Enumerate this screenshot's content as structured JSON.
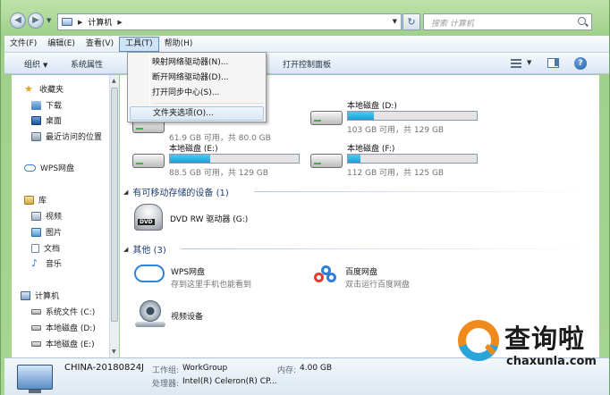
{
  "address_bar": {
    "location": "计算机",
    "search_placeholder": "搜索 计算机"
  },
  "menubar": {
    "items": [
      "文件(F)",
      "编辑(E)",
      "查看(V)",
      "工具(T)",
      "帮助(H)"
    ],
    "active_index": 3
  },
  "toolbar": {
    "organize": "组织",
    "properties": "系统属性",
    "control_panel": "打开控制面板"
  },
  "tools_menu": {
    "items": [
      "映射网络驱动器(N)...",
      "断开网络驱动器(D)...",
      "打开同步中心(S)...",
      "文件夹选项(O)..."
    ],
    "hover_index": 3
  },
  "nav_pane": {
    "favorites": "收藏夹",
    "downloads": "下载",
    "desktop": "桌面",
    "recent": "最近访问的位置",
    "wps_cloud": "WPS网盘",
    "libraries": "库",
    "videos": "视频",
    "pictures": "图片",
    "documents": "文档",
    "music": "音乐",
    "computer": "计算机",
    "drive_c": "系统文件 (C:)",
    "drive_d": "本地磁盘 (D:)",
    "drive_e": "本地磁盘 (E:)"
  },
  "content": {
    "drive_c_free": "61.9 GB 可用，共 80.0 GB",
    "drive_c_used": 0.23,
    "drive_d": {
      "name": "本地磁盘 (D:)",
      "free": "103 GB 可用，共 129 GB",
      "used": 0.2
    },
    "drive_e": {
      "name": "本地磁盘 (E:)",
      "free": "88.5 GB 可用，共 129 GB",
      "used": 0.31
    },
    "drive_f": {
      "name": "本地磁盘 (F:)",
      "free": "112 GB 可用，共 125 GB",
      "used": 0.1
    },
    "removable_header": "有可移动存储的设备 (1)",
    "dvd_label": "DVD RW 驱动器 (G:)",
    "dvd_badge": "DVD",
    "other_header": "其他 (3)",
    "wps": {
      "title": "WPS网盘",
      "subtitle": "存到这里手机也能看到"
    },
    "baidu": {
      "title": "百度网盘",
      "subtitle": "双击运行百度网盘"
    },
    "camera": {
      "title": "视频设备"
    }
  },
  "details": {
    "computer_name": "CHINA-20180824J",
    "workgroup_label": "工作组:",
    "workgroup_value": "WorkGroup",
    "memory_label": "内存:",
    "memory_value": "4.00 GB",
    "cpu_label": "处理器:",
    "cpu_value": "Intel(R) Celeron(R) CP..."
  },
  "watermark": {
    "name_cn": "查询啦",
    "name_en": "chaxunla.com"
  },
  "colors": {
    "accent": "#1ba0d8",
    "window_green": "#9fd08a",
    "menu_highlight": "#cfe3f7"
  },
  "icons": {
    "back": "back-arrow-icon",
    "forward": "forward-arrow-icon",
    "refresh": "refresh-icon",
    "search": "search-icon",
    "help": "help-icon"
  }
}
